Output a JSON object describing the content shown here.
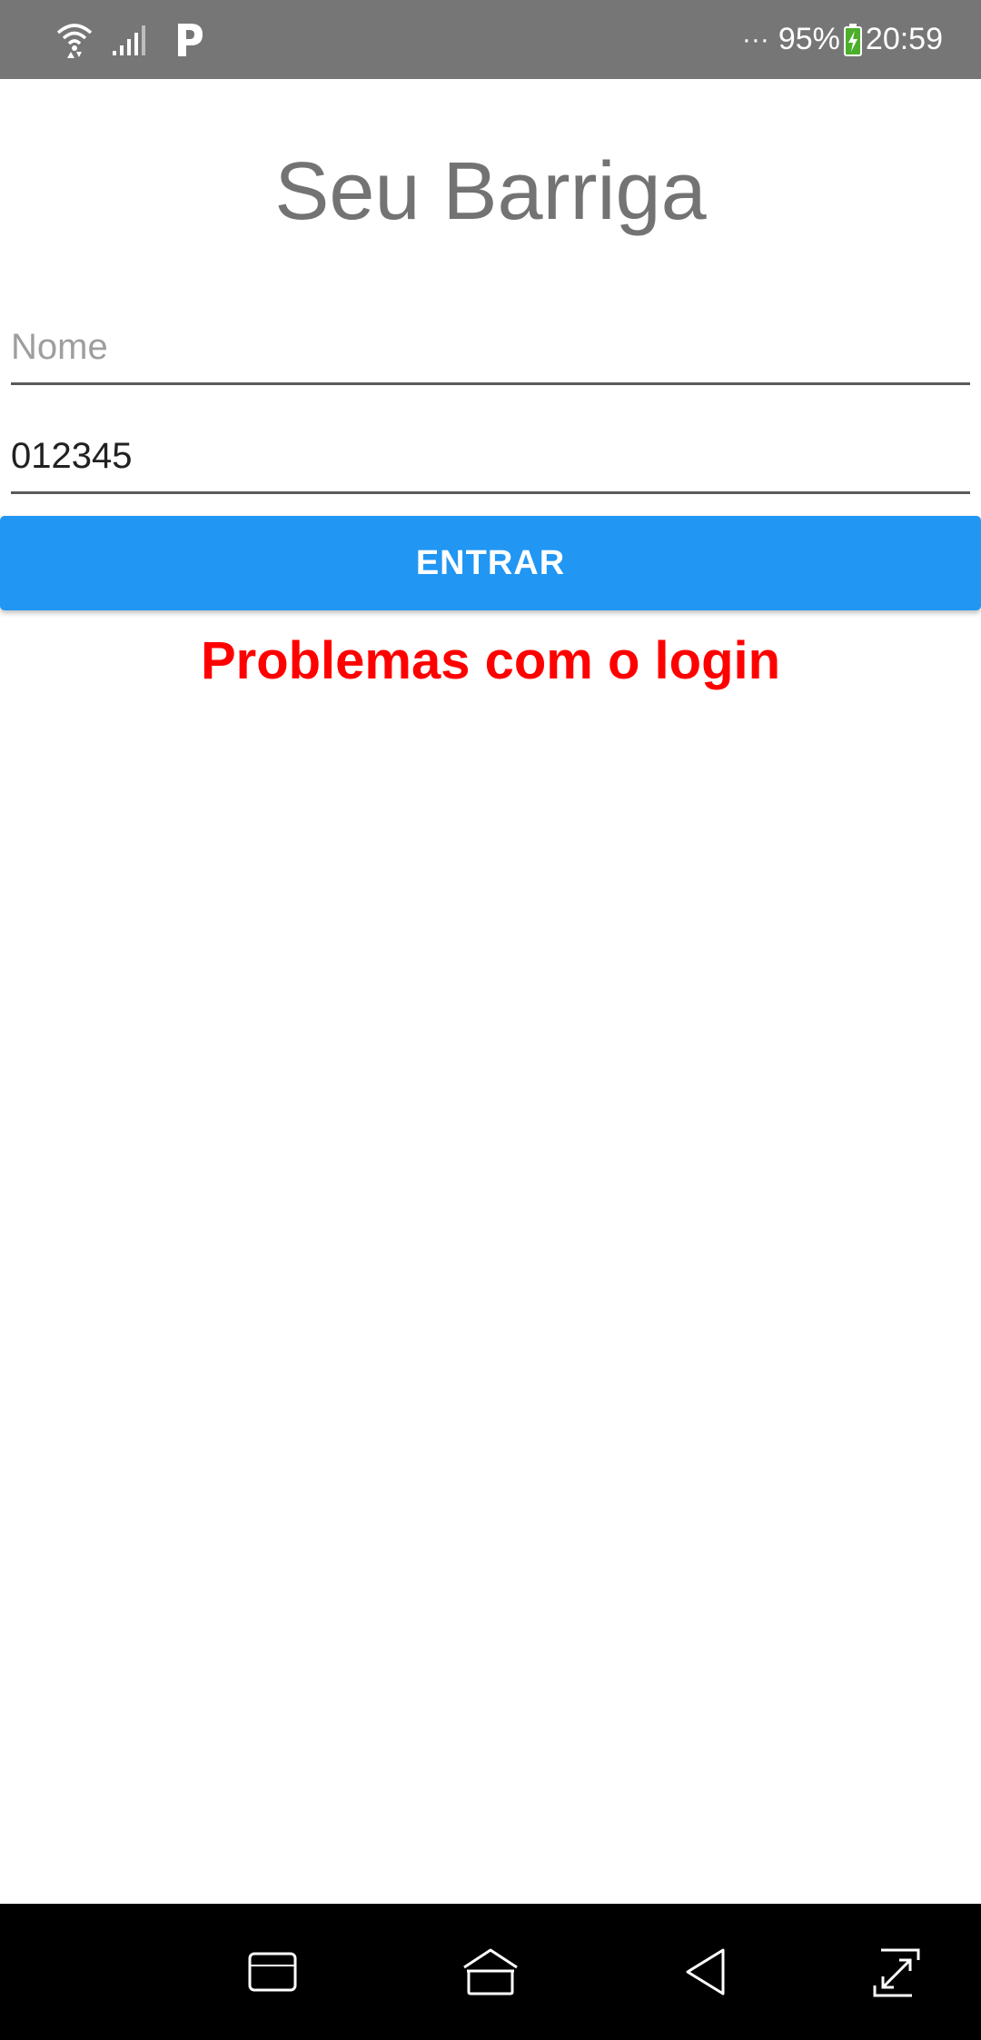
{
  "status_bar": {
    "icons": [
      "wifi-icon",
      "signal-icon",
      "parking-app-icon",
      "battery-charging-icon"
    ],
    "dots": "···",
    "battery": "95%",
    "time": "20:59",
    "battery_color": "#4caf2a"
  },
  "app": {
    "title": "Seu Barriga",
    "nome_placeholder": "Nome",
    "nome_value": "",
    "senha_value": "012345",
    "login_button": "ENTRAR",
    "error_message": "Problemas com o login"
  },
  "colors": {
    "status_bar": "#767676",
    "title": "#737373",
    "button": "#2196f3",
    "error": "#ff0000",
    "nav_bar": "#000000"
  },
  "nav_bar": {
    "icons": [
      "recent-apps-icon",
      "home-icon",
      "back-icon",
      "expand-icon"
    ]
  }
}
